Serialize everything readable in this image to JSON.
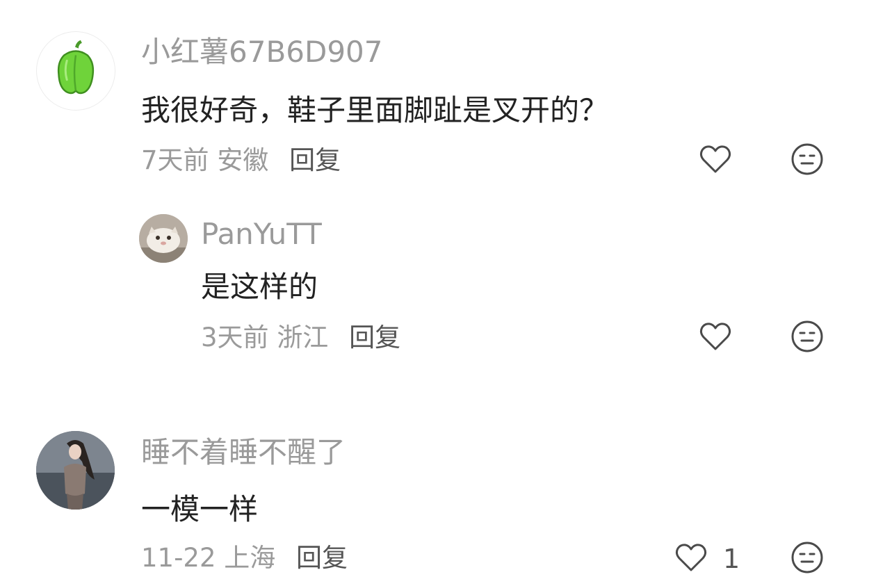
{
  "comments": [
    {
      "username": "小红薯67B6D907",
      "text": "我很好奇，鞋子里面脚趾是叉开的？",
      "time": "7天前",
      "location": "安徽",
      "reply_label": "回复",
      "avatar_icon": "green-pepper-icon"
    },
    {
      "username": "PanYuTT",
      "text": "是这样的",
      "time": "3天前",
      "location": "浙江",
      "reply_label": "回复",
      "avatar_icon": "cat-photo"
    },
    {
      "username": "睡不着睡不醒了",
      "text": "一模一样",
      "time": "11-22",
      "location": "上海",
      "reply_label": "回复",
      "like_count": "1",
      "avatar_icon": "woman-photo"
    }
  ],
  "icons": {
    "like": "heart-icon",
    "dislike": "neutral-face-icon"
  },
  "colors": {
    "username": "#9a9a9a",
    "content": "#222222",
    "meta": "#9a9a9a",
    "reply": "#555555",
    "icon": "#4a4a4a",
    "pepper": "#6fd33a"
  }
}
